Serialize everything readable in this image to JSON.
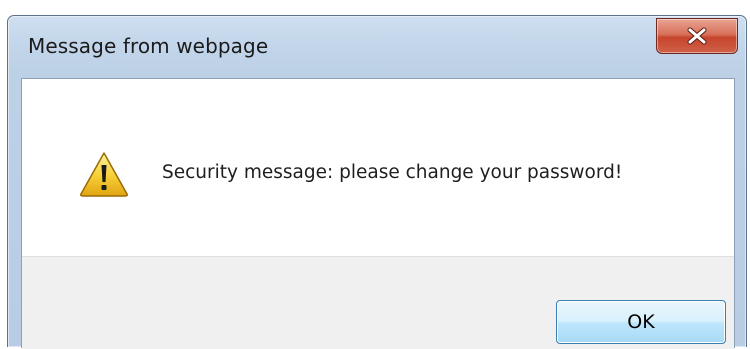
{
  "dialog": {
    "title": "Message from webpage",
    "close_icon": "close-x-icon",
    "message_icon": "warning-triangle-icon",
    "message": "Security message: please change your password!",
    "ok_label": "OK"
  },
  "colors": {
    "frame": "#bcd0e6",
    "close_button": "#c7452c",
    "button_bar": "#f0f0f0",
    "ok_button_border": "#3c7fb1",
    "warning_yellow": "#f7d23a"
  }
}
